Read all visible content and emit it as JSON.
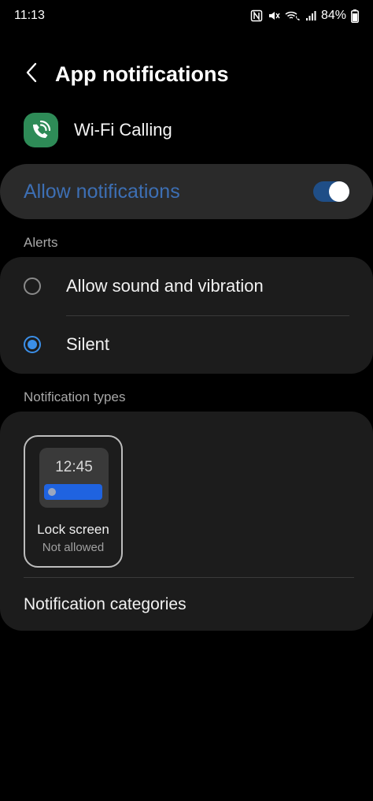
{
  "status_bar": {
    "time": "11:13",
    "battery": "84%",
    "icons": [
      "nfc-icon",
      "mute-icon",
      "wifi-calling-icon",
      "signal-icon",
      "battery-icon"
    ]
  },
  "header": {
    "title": "App notifications",
    "back_icon": "back-chevron-icon"
  },
  "app": {
    "name": "Wi-Fi Calling",
    "icon": "wifi-calling-app-icon",
    "icon_color": "#2e8b57"
  },
  "allow_notifications": {
    "label": "Allow notifications",
    "enabled": true,
    "accent_color": "#3d6fb4"
  },
  "alerts": {
    "section_label": "Alerts",
    "options": [
      {
        "label": "Allow sound and vibration",
        "selected": false
      },
      {
        "label": "Silent",
        "selected": true
      }
    ]
  },
  "notification_types": {
    "section_label": "Notification types",
    "lock_screen": {
      "time": "12:45",
      "title": "Lock screen",
      "status": "Not allowed"
    },
    "categories_label": "Notification categories"
  }
}
